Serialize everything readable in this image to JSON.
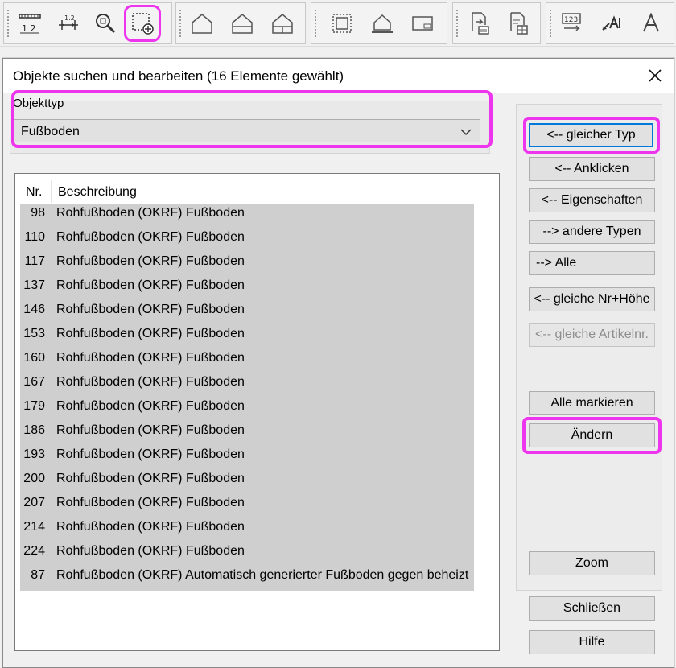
{
  "toolbar": {
    "tools": [
      {
        "icon": "dimension-12-icon"
      },
      {
        "icon": "dimension-chain-icon"
      },
      {
        "icon": "zoom-find-icon"
      },
      {
        "icon": "select-add-icon"
      },
      {
        "icon": "house-outline-icon"
      },
      {
        "icon": "house-floor-icon"
      },
      {
        "icon": "house-room-icon"
      },
      {
        "icon": "wall-frame-icon"
      },
      {
        "icon": "house-base-icon"
      },
      {
        "icon": "window-icon"
      },
      {
        "icon": "document-export-icon"
      },
      {
        "icon": "document-grid-icon"
      },
      {
        "icon": "numbering-icon"
      },
      {
        "icon": "label-arrow-icon"
      },
      {
        "icon": "text-icon"
      }
    ],
    "tool_text": {
      "dim_label": "1 2",
      "dim_small": "1.2",
      "num_label": "123"
    }
  },
  "dialog": {
    "title": "Objekte suchen und bearbeiten (16 Elemente gewählt)",
    "object_type_label": "Objekttyp",
    "object_type_value": "Fußboden",
    "list_headers": {
      "nr": "Nr.",
      "description": "Beschreibung"
    },
    "rows": [
      {
        "nr": "98",
        "desc": "Rohfußboden (OKRF) Fußboden"
      },
      {
        "nr": "110",
        "desc": "Rohfußboden (OKRF) Fußboden"
      },
      {
        "nr": "117",
        "desc": "Rohfußboden (OKRF) Fußboden"
      },
      {
        "nr": "137",
        "desc": "Rohfußboden (OKRF) Fußboden"
      },
      {
        "nr": "146",
        "desc": "Rohfußboden (OKRF) Fußboden"
      },
      {
        "nr": "153",
        "desc": "Rohfußboden (OKRF) Fußboden"
      },
      {
        "nr": "160",
        "desc": "Rohfußboden (OKRF) Fußboden"
      },
      {
        "nr": "167",
        "desc": "Rohfußboden (OKRF) Fußboden"
      },
      {
        "nr": "179",
        "desc": "Rohfußboden (OKRF) Fußboden"
      },
      {
        "nr": "186",
        "desc": "Rohfußboden (OKRF) Fußboden"
      },
      {
        "nr": "193",
        "desc": "Rohfußboden (OKRF) Fußboden"
      },
      {
        "nr": "200",
        "desc": "Rohfußboden (OKRF) Fußboden"
      },
      {
        "nr": "207",
        "desc": "Rohfußboden (OKRF) Fußboden"
      },
      {
        "nr": "214",
        "desc": "Rohfußboden (OKRF) Fußboden"
      },
      {
        "nr": "224",
        "desc": "Rohfußboden (OKRF) Fußboden"
      },
      {
        "nr": "87",
        "desc": "Rohfußboden (OKRF) Automatisch generierter Fußboden gegen beheizt"
      }
    ],
    "buttons": {
      "same_type": "<-- gleicher Typ",
      "click": "<-- Anklicken",
      "properties": "<-- Eigenschaften",
      "other_types": "--> andere Typen",
      "all": "--> Alle",
      "same_nr_height": "<-- gleiche Nr+Höhe",
      "same_article": "<-- gleiche Artikelnr.",
      "mark_all": "Alle markieren",
      "change": "Ändern",
      "zoom": "Zoom",
      "close": "Schließen",
      "help": "Hilfe"
    }
  },
  "colors": {
    "highlight": "#ee35ee",
    "selection_bg": "#cfcfcf",
    "focus_border": "#0078d7"
  }
}
